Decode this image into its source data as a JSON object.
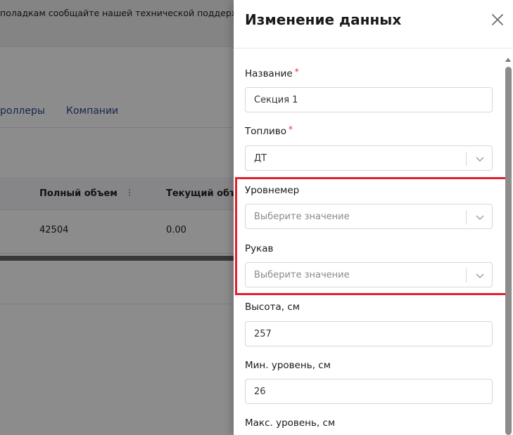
{
  "background": {
    "banner_text": "поладкам сообщайте нашей технической поддерж",
    "tabs": [
      "роллеры",
      "Компании"
    ],
    "table": {
      "headers": [
        "Полный объем",
        "Текущий объем"
      ],
      "row": [
        "42504",
        "0.00"
      ]
    }
  },
  "drawer": {
    "title": "Изменение данных",
    "fields": {
      "name": {
        "label": "Название",
        "required": "*",
        "value": "Секция 1"
      },
      "fuel": {
        "label": "Топливо",
        "required": "*",
        "value": "ДТ"
      },
      "level_gauge": {
        "label": "Уровнемер",
        "placeholder": "Выберите значение"
      },
      "hose": {
        "label": "Рукав",
        "placeholder": "Выберите значение"
      },
      "height": {
        "label": "Высота, см",
        "value": "257"
      },
      "min_level": {
        "label": "Мин. уровень, см",
        "value": "26"
      },
      "max_level": {
        "label": "Макс. уровень, см"
      }
    }
  },
  "colors": {
    "highlight": "#e3202c",
    "required": "#e03131",
    "link": "#2b4a8a"
  },
  "icons": {
    "close": "close-icon",
    "dropdown": "chevron-down-icon",
    "kebab": "kebab-icon"
  }
}
